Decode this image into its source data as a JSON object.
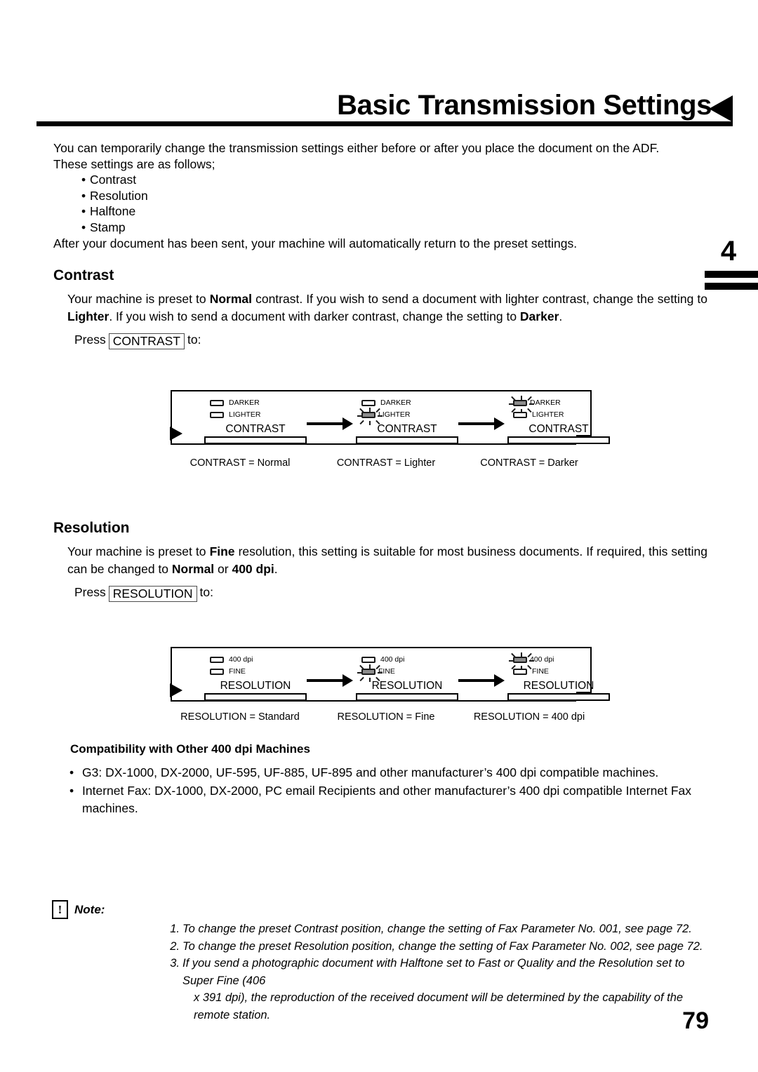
{
  "header": {
    "title": "Basic Transmission Settings",
    "triangle_icon": "left-triangle-icon"
  },
  "chapter": {
    "number": "4"
  },
  "intro": {
    "line1": "You can temporarily change the transmission settings either before or after you place the document on the ADF.",
    "line2": "These settings are as follows;",
    "bullets": [
      "Contrast",
      "Resolution",
      "Halftone",
      "Stamp"
    ],
    "closing": "After your document has been sent, your machine will automatically return to the preset settings."
  },
  "contrast": {
    "heading": "Contrast",
    "paragraph_line1": "Your machine is preset to ",
    "bold1": "Normal",
    "paragraph_line2": " contrast.  If you wish to send a document with lighter contrast, change the setting to ",
    "bold2": "Lighter",
    "paragraph_line3": ".  If you wish to send a document with darker contrast, change the setting to ",
    "bold3": "Darker",
    "paragraph_line4": ".",
    "press_prefix": "Press",
    "key_label": "CONTRAST",
    "press_suffix": "to:",
    "panels": [
      {
        "leds": [
          {
            "label": "DARKER",
            "state": "off"
          },
          {
            "label": "LIGHTER",
            "state": "off"
          }
        ],
        "key_label": "CONTRAST",
        "caption": "CONTRAST = Normal"
      },
      {
        "leds": [
          {
            "label": "DARKER",
            "state": "off"
          },
          {
            "label": "LIGHTER",
            "state": "on"
          }
        ],
        "key_label": "CONTRAST",
        "caption": "CONTRAST = Lighter"
      },
      {
        "leds": [
          {
            "label": "DARKER",
            "state": "on"
          },
          {
            "label": "LIGHTER",
            "state": "off"
          }
        ],
        "key_label": "CONTRAST",
        "caption": "CONTRAST = Darker"
      }
    ]
  },
  "resolution": {
    "heading": "Resolution",
    "bold1": "Fine",
    "bold2": "Normal",
    "bold3": "400 dpi",
    "press_prefix": "Press",
    "key_label": "RESOLUTION",
    "press_suffix": "to:",
    "panels": [
      {
        "leds": [
          {
            "label": "400 dpi",
            "state": "off"
          },
          {
            "label": "FINE",
            "state": "off"
          }
        ],
        "key_label": "RESOLUTION",
        "caption": "RESOLUTION = Standard"
      },
      {
        "leds": [
          {
            "label": "400 dpi",
            "state": "off"
          },
          {
            "label": "FINE",
            "state": "on"
          }
        ],
        "key_label": "RESOLUTION",
        "caption": "RESOLUTION = Fine"
      },
      {
        "leds": [
          {
            "label": "400 dpi",
            "state": "on"
          },
          {
            "label": "FINE",
            "state": "off"
          }
        ],
        "key_label": "RESOLUTION",
        "caption": "RESOLUTION = 400 dpi"
      }
    ]
  },
  "compatibility": {
    "title": "Compatibility with Other 400 dpi Machines",
    "items": [
      "G3: DX-1000, DX-2000, UF-595, UF-885, UF-895 and other manufacturer’s 400 dpi compatible machines.",
      "Internet Fax: DX-1000, DX-2000, PC email Recipients and other manufacturer’s 400 dpi compatible Internet Fax machines."
    ]
  },
  "note": {
    "icon": "exclamation-icon",
    "bang": "!",
    "label": "Note:",
    "items": [
      {
        "num": "1.",
        "text": "To change the preset Contrast position, change the setting of Fax Parameter No. 001, see page 72."
      },
      {
        "num": "2.",
        "text": "To change the preset Resolution position, change the setting of Fax Parameter No. 002, see page 72."
      },
      {
        "num": "3.",
        "text": "If you send a photographic document with Halftone set to Fast or Quality and the Resolution set to Super Fine (406",
        "text2": "x 391 dpi), the reproduction of the received document will be determined by the capability of the remote station."
      }
    ]
  },
  "footer": {
    "page_number": "79"
  }
}
